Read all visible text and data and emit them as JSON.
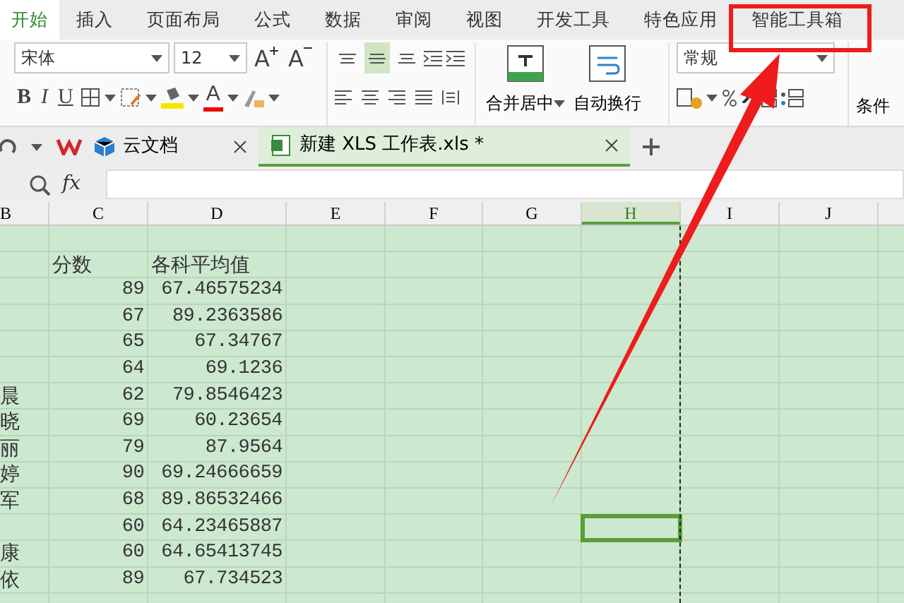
{
  "menu_tabs": [
    {
      "label": "开始",
      "selected": true,
      "highlighted": false
    },
    {
      "label": "插入",
      "selected": false,
      "highlighted": false
    },
    {
      "label": "页面布局",
      "selected": false,
      "highlighted": false
    },
    {
      "label": "公式",
      "selected": false,
      "highlighted": false
    },
    {
      "label": "数据",
      "selected": false,
      "highlighted": false
    },
    {
      "label": "审阅",
      "selected": false,
      "highlighted": false
    },
    {
      "label": "视图",
      "selected": false,
      "highlighted": false
    },
    {
      "label": "开发工具",
      "selected": false,
      "highlighted": false
    },
    {
      "label": "特色应用",
      "selected": false,
      "highlighted": false
    },
    {
      "label": "智能工具箱",
      "selected": false,
      "highlighted": true
    }
  ],
  "toolbar": {
    "font_name": "宋体",
    "font_size": "12",
    "size_buttons": [
      {
        "kind": "grow",
        "label": "A"
      },
      {
        "kind": "shrink",
        "label": "A"
      }
    ],
    "style_buttons": [
      {
        "kind": "bold",
        "label": "B"
      },
      {
        "kind": "italic",
        "label": "I"
      },
      {
        "kind": "underline",
        "label": "U"
      }
    ],
    "font_color_button": {
      "label": "A"
    },
    "vertical_align": [
      {
        "kind": "top",
        "selected": false
      },
      {
        "kind": "middle",
        "selected": true
      },
      {
        "kind": "bottom",
        "selected": false
      }
    ],
    "merge_button": "合并居中",
    "wrap_button": "自动换行",
    "number_format": "常规",
    "conditional_button": "条件"
  },
  "doc_tabs": [
    {
      "kind": "cloud",
      "label": "云文档",
      "selected": false
    },
    {
      "kind": "sheet",
      "label": "新建 XLS 工作表.xls *",
      "selected": true
    }
  ],
  "formula_bar": {
    "fx_label": "fx"
  },
  "columns": [
    {
      "label": "B",
      "selected": false
    },
    {
      "label": "C",
      "selected": false
    },
    {
      "label": "D",
      "selected": false
    },
    {
      "label": "E",
      "selected": false
    },
    {
      "label": "F",
      "selected": false
    },
    {
      "label": "G",
      "selected": false
    },
    {
      "label": "H",
      "selected": true
    },
    {
      "label": "I",
      "selected": false
    },
    {
      "label": "J",
      "selected": false
    }
  ],
  "rows": [
    {
      "kind": "blank",
      "selected": false
    },
    {
      "kind": "header",
      "cells": [
        "",
        "分数",
        "各科平均值"
      ],
      "selected": false
    },
    {
      "kind": "data",
      "cells": [
        "",
        "89",
        "67.46575234"
      ],
      "selected": false
    },
    {
      "kind": "data",
      "cells": [
        "",
        "67",
        "89.2363586"
      ],
      "selected": false
    },
    {
      "kind": "data",
      "cells": [
        "",
        "65",
        "67.34767"
      ],
      "selected": false
    },
    {
      "kind": "data",
      "cells": [
        "",
        "64",
        "69.1236"
      ],
      "selected": false
    },
    {
      "kind": "data",
      "cells": [
        "晨",
        "62",
        "79.8546423"
      ],
      "selected": false
    },
    {
      "kind": "data",
      "cells": [
        "晓",
        "69",
        "60.23654"
      ],
      "selected": false
    },
    {
      "kind": "data",
      "cells": [
        "丽",
        "79",
        "87.9564"
      ],
      "selected": false
    },
    {
      "kind": "data",
      "cells": [
        "婷",
        "90",
        "69.24666659"
      ],
      "selected": false
    },
    {
      "kind": "data",
      "cells": [
        "军",
        "68",
        "89.86532466"
      ],
      "selected": false
    },
    {
      "kind": "data",
      "cells": [
        "",
        "60",
        "64.23465887"
      ],
      "selected": true
    },
    {
      "kind": "data",
      "cells": [
        "康",
        "60",
        "64.65413745"
      ],
      "selected": false
    },
    {
      "kind": "data",
      "cells": [
        "依",
        "89",
        "67.734523"
      ],
      "selected": false
    },
    {
      "kind": "blank",
      "selected": false
    }
  ]
}
